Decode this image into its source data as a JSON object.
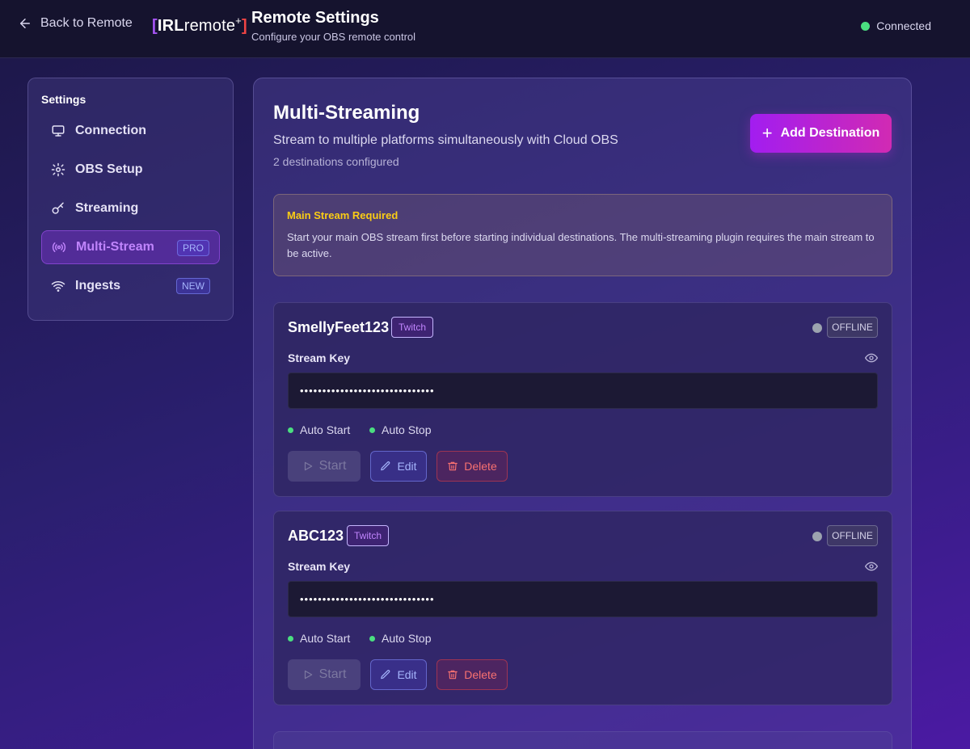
{
  "header": {
    "back_label": "Back to Remote",
    "logo": {
      "left_bracket": "[",
      "irl": "IRL",
      "remote": "remote",
      "plus": "+",
      "right_bracket": "]"
    },
    "title": "Remote Settings",
    "subtitle": "Configure your OBS remote control",
    "status_label": "Connected",
    "status_color": "#4ade80"
  },
  "sidebar": {
    "heading": "Settings",
    "items": [
      {
        "label": "Connection",
        "icon": "monitor-icon"
      },
      {
        "label": "OBS Setup",
        "icon": "gear-icon"
      },
      {
        "label": "Streaming",
        "icon": "key-icon"
      },
      {
        "label": "Multi-Stream",
        "icon": "broadcast-icon",
        "badge": "PRO",
        "active": true
      },
      {
        "label": "Ingests",
        "icon": "wifi-icon",
        "badge": "NEW"
      }
    ]
  },
  "main": {
    "title": "Multi-Streaming",
    "subtitle": "Stream to multiple platforms simultaneously with Cloud OBS",
    "count": "2 destinations configured",
    "add_button": "Add Destination",
    "add_button_icon": "+",
    "warning": {
      "title": "Main Stream Required",
      "body": "Start your main OBS stream first before starting individual destinations. The multi-streaming plugin requires the main stream to be active."
    },
    "destinations": [
      {
        "name": "SmellyFeet123",
        "platform": "Twitch",
        "status": "OFFLINE",
        "key_label": "Stream Key",
        "key_value": "••••••••••••••••••••••••••••••",
        "auto_start": "Auto Start",
        "auto_stop": "Auto Stop",
        "start_label": "Start",
        "edit_label": "Edit",
        "delete_label": "Delete"
      },
      {
        "name": "ABC123",
        "platform": "Twitch",
        "status": "OFFLINE",
        "key_label": "Stream Key",
        "key_value": "••••••••••••••••••••••••••••••",
        "auto_start": "Auto Start",
        "auto_stop": "Auto Stop",
        "start_label": "Start",
        "edit_label": "Edit",
        "delete_label": "Delete"
      }
    ]
  }
}
